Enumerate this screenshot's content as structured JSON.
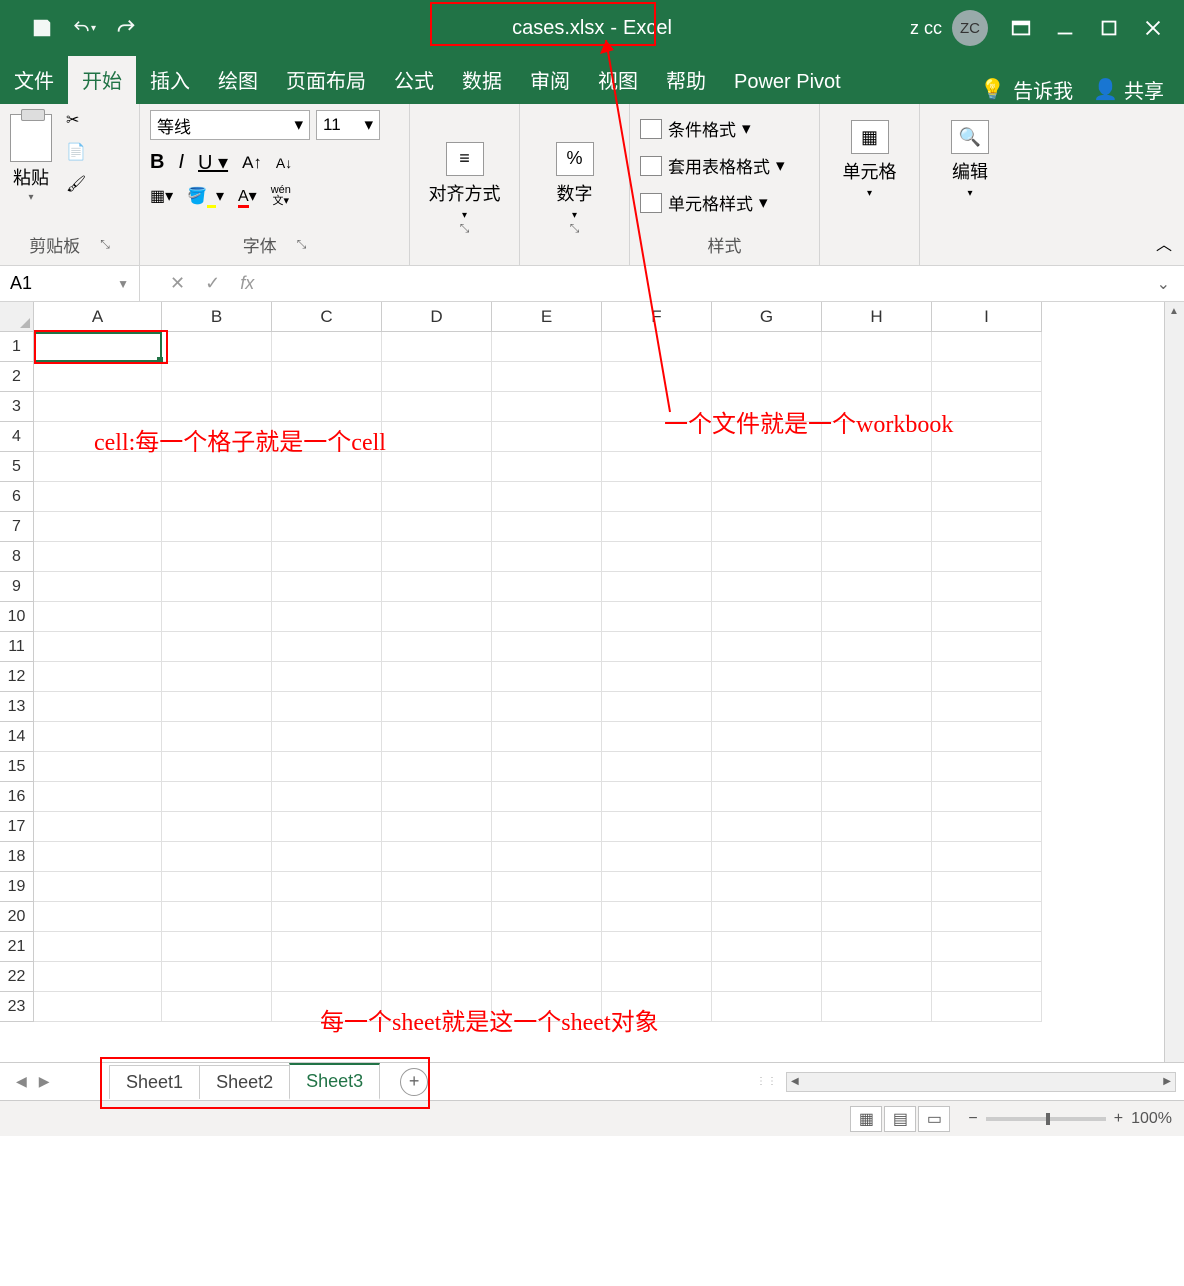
{
  "title": {
    "filename": "cases.xlsx",
    "sep": "-",
    "app": "Excel"
  },
  "user": {
    "name": "z cc",
    "initials": "ZC"
  },
  "tabs": [
    "文件",
    "开始",
    "插入",
    "绘图",
    "页面布局",
    "公式",
    "数据",
    "审阅",
    "视图",
    "帮助",
    "Power Pivot"
  ],
  "active_tab": 1,
  "tell_me": "告诉我",
  "share": "共享",
  "ribbon": {
    "clipboard": {
      "paste": "粘贴",
      "label": "剪贴板"
    },
    "font": {
      "name": "等线",
      "size": "11",
      "label": "字体",
      "wen": "wén",
      "wen2": "文"
    },
    "align": {
      "label": "对齐方式"
    },
    "number": {
      "symbol": "%",
      "label": "数字"
    },
    "styles": {
      "cond": "条件格式",
      "table": "套用表格格式",
      "cell": "单元格样式",
      "label": "样式"
    },
    "cells": {
      "label": "单元格"
    },
    "edit": {
      "label": "编辑"
    }
  },
  "namebox": "A1",
  "fx": "fx",
  "columns": [
    "A",
    "B",
    "C",
    "D",
    "E",
    "F",
    "G",
    "H",
    "I"
  ],
  "row_count": 23,
  "sheets": [
    "Sheet1",
    "Sheet2",
    "Sheet3"
  ],
  "active_sheet": 2,
  "status": {
    "ready": "",
    "zoom": "100%",
    "plus": "+",
    "minus": "−"
  },
  "annotations": {
    "cell": "cell:每一个格子就是一个cell",
    "workbook": "一个文件就是一个workbook",
    "sheet": "每一个sheet就是这一个sheet对象"
  }
}
